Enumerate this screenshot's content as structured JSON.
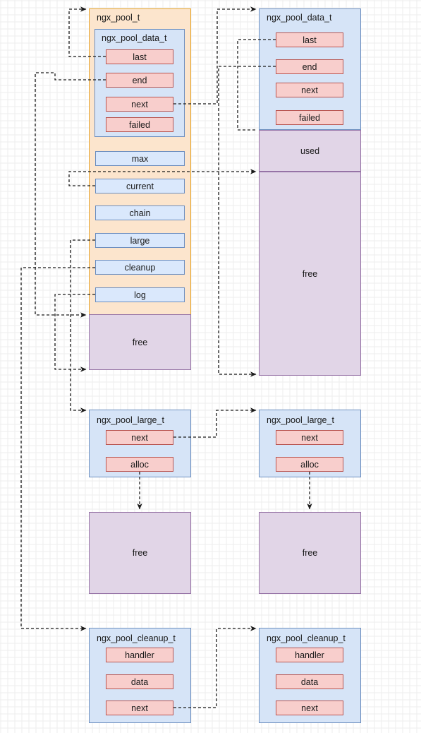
{
  "diagram": {
    "title_left_pool": "ngx_pool_t",
    "structs": {
      "pool_data": "ngx_pool_data_t",
      "pool_large": "ngx_pool_large_t",
      "pool_cleanup": "ngx_pool_cleanup_t"
    },
    "memory_labels": {
      "used": "used",
      "free": "free"
    },
    "colors": {
      "pool_outer_fill": "#fce5cd",
      "pool_outer_stroke": "#e6a329",
      "struct_fill": "#d6e4f7",
      "struct_stroke": "#6c8ebf",
      "field_red_fill": "#f8cecc",
      "field_red_stroke": "#b85450",
      "field_blue_fill": "#dae8fc",
      "field_blue_stroke": "#6c8ebf",
      "memory_fill": "#e1d5e7",
      "memory_stroke": "#9673a6",
      "wire_stroke": "#1a1a1a"
    },
    "left_pool": {
      "data_fields": [
        "last",
        "end",
        "next",
        "failed"
      ],
      "pool_fields": [
        "max",
        "current",
        "chain",
        "large",
        "cleanup",
        "log"
      ],
      "free_label": "free"
    },
    "right_pool": {
      "data_fields": [
        "last",
        "end",
        "next",
        "failed"
      ],
      "used_label": "used",
      "free_label": "free"
    },
    "large_left": {
      "title": "ngx_pool_large_t",
      "fields": [
        "next",
        "alloc"
      ],
      "block_label": "free"
    },
    "large_right": {
      "title": "ngx_pool_large_t",
      "fields": [
        "next",
        "alloc"
      ],
      "block_label": "free"
    },
    "cleanup_left": {
      "title": "ngx_pool_cleanup_t",
      "fields": [
        "handler",
        "data",
        "next"
      ]
    },
    "cleanup_right": {
      "title": "ngx_pool_cleanup_t",
      "fields": [
        "handler",
        "data",
        "next"
      ]
    }
  }
}
